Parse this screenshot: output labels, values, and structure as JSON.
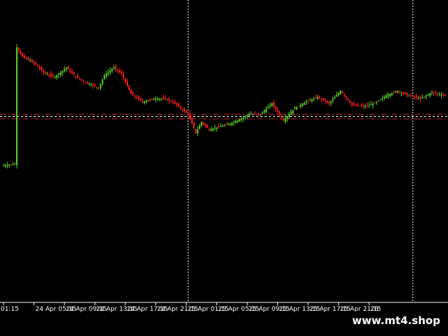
{
  "watermark": "www.mt4.shop",
  "colors": {
    "background": "#000000",
    "bull": "#5cd32a",
    "bear": "#ff2020",
    "axis": "#ffffff",
    "vline": "#ffffff",
    "hline_red": "#c0282a",
    "hline_white": "#ffffff"
  },
  "chart_data": {
    "type": "candlestick",
    "title": "",
    "xlabel": "",
    "ylabel": "",
    "grid": false,
    "x_tick_labels": [
      "01:15",
      "24 Apr 05:15",
      "24 Apr 09:15",
      "24 Apr 13:15",
      "24 Apr 17:15",
      "24 Apr 21:15",
      "25 Apr 01:15",
      "25 Apr 05:15",
      "25 Apr 09:15",
      "25 Apr 13:15",
      "25 Apr 17:15",
      "25 Apr 21:15",
      "26"
    ],
    "price_range": [
      0,
      100
    ],
    "bars_between_ticks": 16,
    "close_path": [
      [
        0,
        7
      ],
      [
        6,
        8
      ],
      [
        7,
        83
      ],
      [
        10,
        77
      ],
      [
        16,
        73
      ],
      [
        22,
        66
      ],
      [
        27,
        64
      ],
      [
        33,
        70
      ],
      [
        38,
        64
      ],
      [
        44,
        60
      ],
      [
        50,
        57
      ],
      [
        53,
        65
      ],
      [
        58,
        70
      ],
      [
        62,
        66
      ],
      [
        67,
        53
      ],
      [
        73,
        48
      ],
      [
        79,
        50
      ],
      [
        85,
        50
      ],
      [
        90,
        47
      ],
      [
        97,
        40
      ],
      [
        101,
        28
      ],
      [
        104,
        35
      ],
      [
        108,
        30
      ],
      [
        113,
        32
      ],
      [
        117,
        33
      ],
      [
        123,
        36
      ],
      [
        129,
        40
      ],
      [
        135,
        40
      ],
      [
        141,
        47
      ],
      [
        147,
        36
      ],
      [
        153,
        44
      ],
      [
        159,
        48
      ],
      [
        165,
        51
      ],
      [
        171,
        47
      ],
      [
        177,
        55
      ],
      [
        183,
        46
      ],
      [
        189,
        45
      ],
      [
        195,
        47
      ],
      [
        201,
        52
      ],
      [
        207,
        55
      ],
      [
        213,
        52
      ],
      [
        219,
        50
      ],
      [
        225,
        54
      ],
      [
        232,
        52
      ]
    ],
    "vertical_marker_bars": [
      97,
      215
    ],
    "horizontal_levels": [
      {
        "level": 40,
        "style": "red-dashdot"
      },
      {
        "level": 38.5,
        "style": "white-dashed"
      },
      {
        "level": 37,
        "style": "red-dashdot"
      }
    ]
  }
}
